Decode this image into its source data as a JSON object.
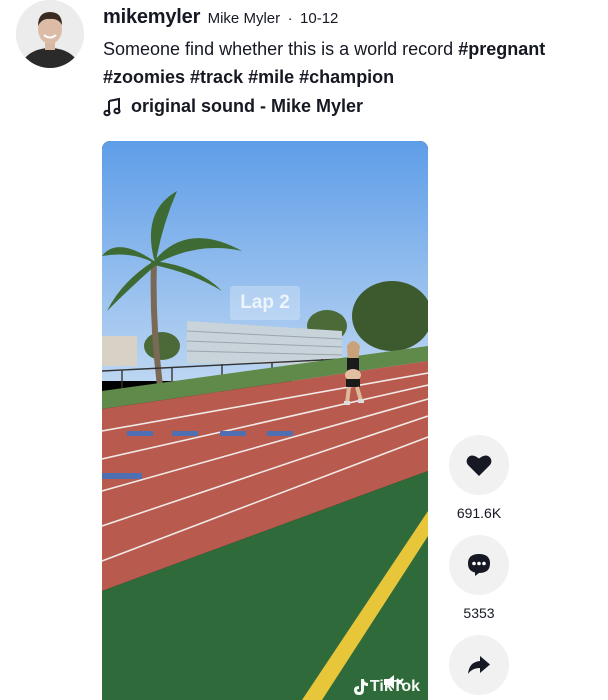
{
  "author": {
    "username": "mikemyler",
    "nickname": "Mike Myler",
    "separator": "·",
    "date": "10-12"
  },
  "caption": {
    "text": "Someone find whether this is a world record",
    "hashtags": [
      "#pregnant",
      "#zoomies",
      "#track",
      "#mile",
      "#champion"
    ]
  },
  "music": {
    "icon": "music-note-icon",
    "label": "original sound - Mike Myler"
  },
  "video": {
    "overlay_text": "Lap 2",
    "watermark": "TikTok"
  },
  "actions": {
    "like": {
      "icon": "heart-icon",
      "count": "691.6K"
    },
    "comment": {
      "icon": "comment-icon",
      "count": "5353"
    },
    "share": {
      "icon": "share-icon",
      "count": ""
    }
  },
  "colors": {
    "text": "#161823",
    "button_bg": "#f1f1f2",
    "track_red": "#b85a4e",
    "turf_green": "#2f6b3a",
    "sky_blue": "#7fb3ee"
  }
}
